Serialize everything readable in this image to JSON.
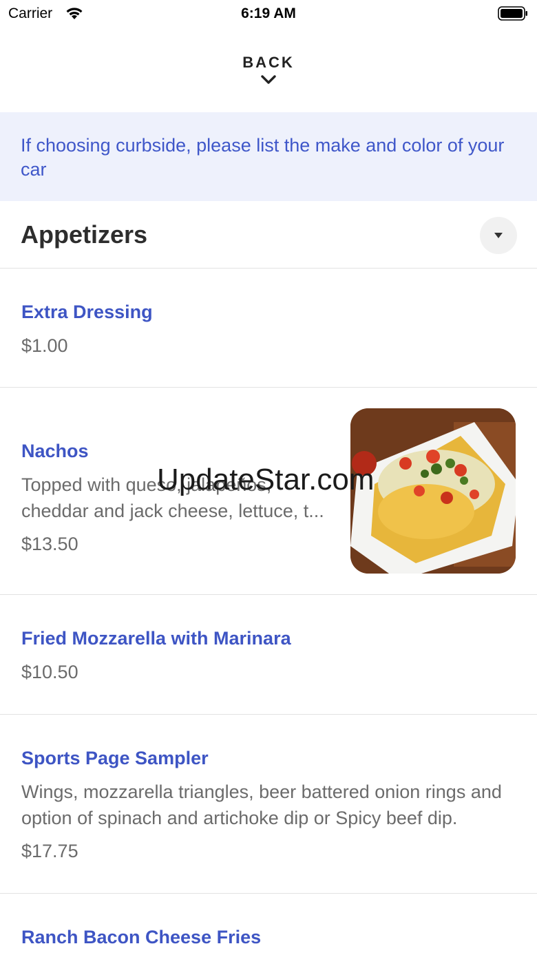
{
  "status_bar": {
    "carrier": "Carrier",
    "time": "6:19 AM"
  },
  "nav": {
    "back_label": "BACK"
  },
  "notice": "If choosing curbside, please list the make and color of your car",
  "section": {
    "title": "Appetizers"
  },
  "items": [
    {
      "name": "Extra Dressing",
      "price": "$1.00"
    },
    {
      "name": "Nachos",
      "description": "Topped with queso, jalapeños, cheddar and jack cheese, lettuce, t...",
      "price": "$13.50",
      "image": "nachos-photo"
    },
    {
      "name": "Fried Mozzarella with Marinara",
      "price": "$10.50"
    },
    {
      "name": "Sports Page Sampler",
      "description": "Wings, mozzarella triangles, beer battered onion rings and option of spinach and artichoke dip or Spicy beef dip.",
      "price": "$17.75"
    },
    {
      "name": "Ranch Bacon Cheese Fries"
    }
  ],
  "watermark": "UpdateStar.com",
  "colors": {
    "accent": "#3e55c4",
    "notice_bg": "#eef1fc",
    "notice_text": "#3f57c9",
    "price_text": "#6b6b6b"
  }
}
